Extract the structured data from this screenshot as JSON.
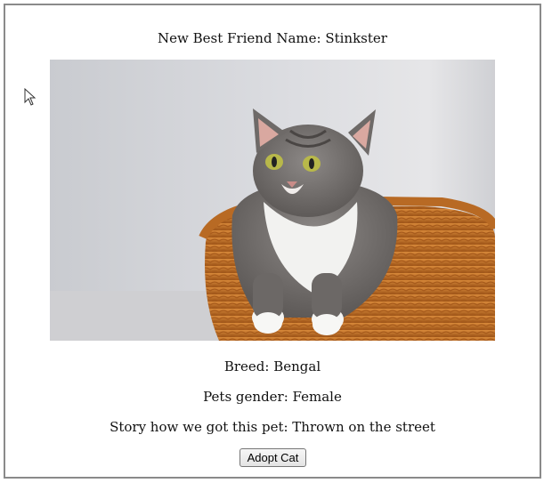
{
  "pet": {
    "name_line": "New Best Friend Name: Stinkster",
    "breed_line": "Breed: Bengal",
    "gender_line": "Pets gender: Female",
    "story_line": "Story how we got this pet: Thrown on the street"
  },
  "photo": {
    "icon": "cat-in-basket-photo"
  },
  "actions": {
    "adopt_label": "Adopt Cat"
  },
  "colors": {
    "frame_border": "#8a8a8a",
    "photo_wall": "#d6d8dd",
    "basket": "#c8762a",
    "cat_fur": "#7a7674",
    "cat_chest": "#f2f2f0",
    "cat_eyes": "#b8b84a"
  }
}
